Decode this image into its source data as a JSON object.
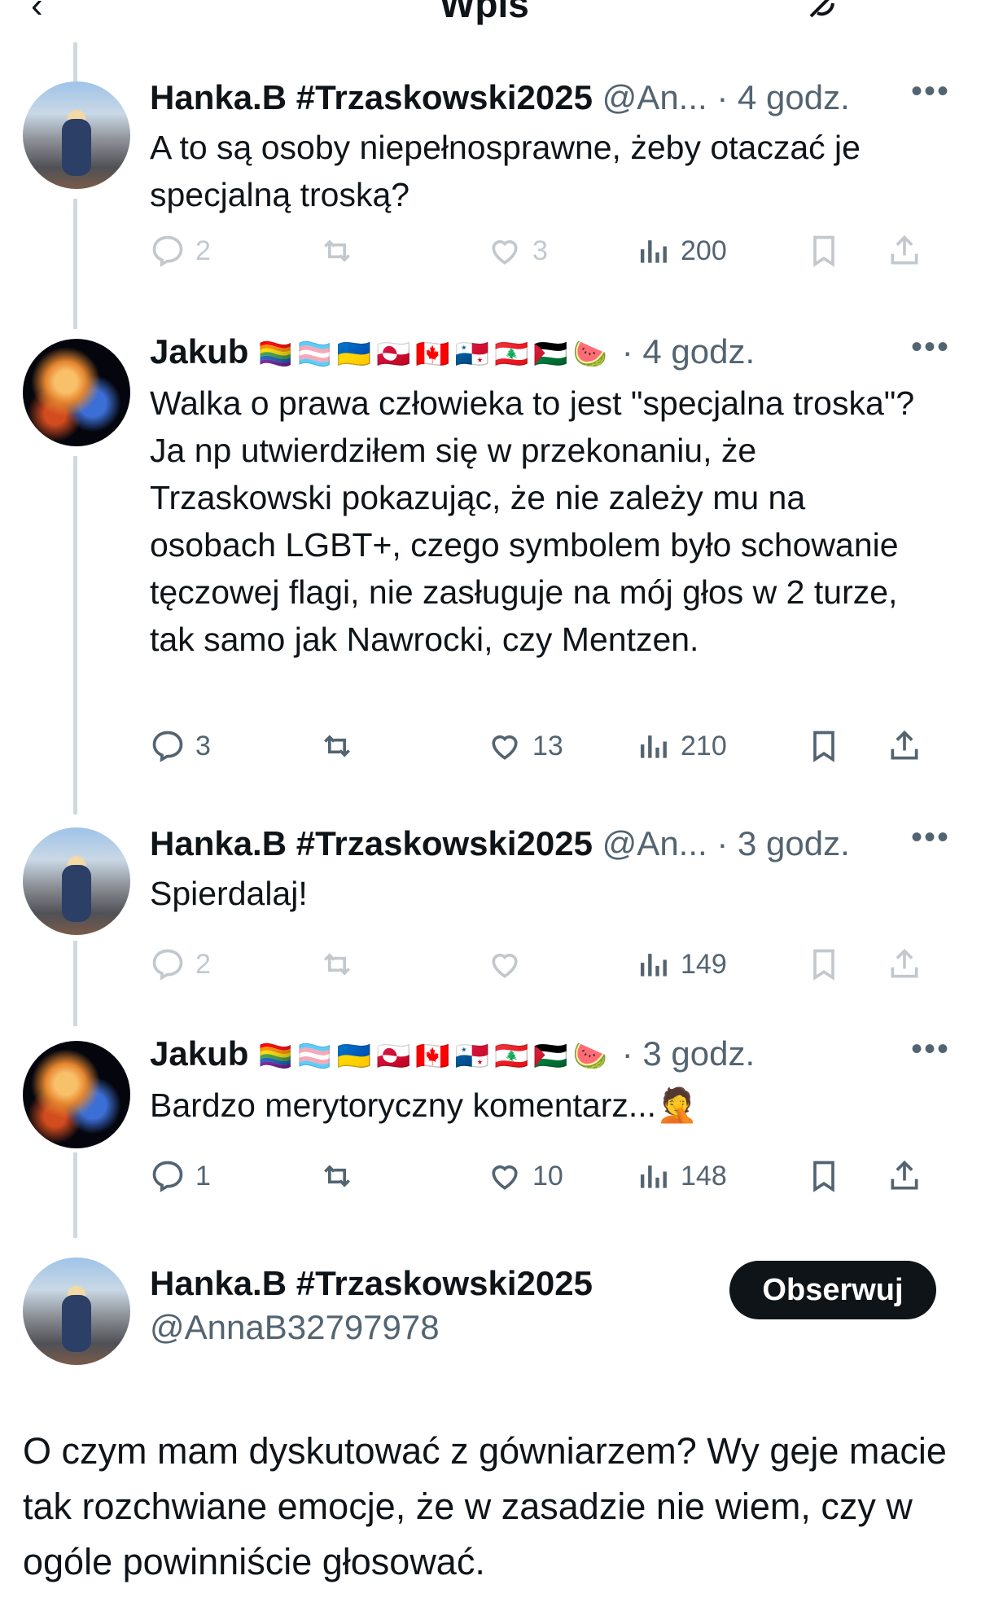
{
  "topbar": {
    "back_glyph": "‹",
    "title": "Wpis",
    "icon": "grok-icon"
  },
  "tweets": [
    {
      "name": "Hanka.B #Trzaskowski2025",
      "handle": "@An...",
      "time": "· 4 godz.",
      "text": "A to są osoby niepełnosprawne, żeby otaczać je specjalną troską?",
      "replies": "2",
      "retweets": "",
      "likes": "3",
      "views": "200"
    },
    {
      "name": "Jakub",
      "flags": "🏳️‍🌈🏳️‍⚧️🇺🇦🇬🇱🇨🇦🇵🇦🇱🇧🇵🇸🍉",
      "time": "· 4 godz.",
      "text": "Walka o prawa człowieka to jest \"specjalna troska\"? Ja np utwierdziłem się w przekonaniu, że Trzaskowski pokazując, że nie zależy mu na osobach LGBT+, czego symbolem było schowanie tęczowej flagi, nie zasługuje na mój głos w 2 turze, tak samo jak Nawrocki, czy Mentzen.",
      "replies": "3",
      "retweets": "",
      "likes": "13",
      "views": "210"
    },
    {
      "name": "Hanka.B #Trzaskowski2025",
      "handle": "@An...",
      "time": "· 3 godz.",
      "text": "Spierdalaj!",
      "replies": "2",
      "retweets": "",
      "likes": "",
      "views": "149"
    },
    {
      "name": "Jakub",
      "flags": "🏳️‍🌈🏳️‍⚧️🇺🇦🇬🇱🇨🇦🇵🇦🇱🇧🇵🇸🍉",
      "time": "· 3 godz.",
      "text": "Bardzo merytoryczny komentarz...🤦",
      "replies": "1",
      "retweets": "",
      "likes": "10",
      "views": "148"
    }
  ],
  "main_tweet": {
    "name": "Hanka.B #Trzaskowski2025",
    "handle": "@AnnaB32797978",
    "follow_label": "Obserwuj",
    "text": "O czym mam dyskutować z gówniarzem? Wy geje macie tak rozchwiane emocje, że w zasadzie nie wiem, czy w ogóle powinniście głosować."
  },
  "more_glyph": "•••",
  "colors": {
    "text": "#0f1419",
    "muted": "#536471",
    "thread_line": "#cfd9de",
    "button": "#0f1419"
  }
}
